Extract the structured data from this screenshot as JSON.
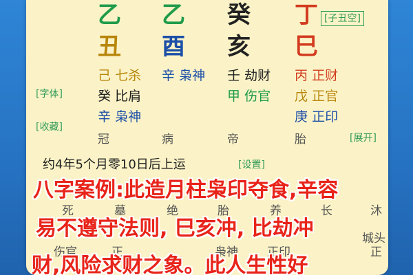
{
  "pillars": {
    "stems": [
      {
        "char": "乙",
        "color": "#1f9b4a"
      },
      {
        "char": "乙",
        "color": "#1f9b4a"
      },
      {
        "char": "癸",
        "color": "#222222"
      },
      {
        "char": "丁",
        "color": "#d23b1f"
      }
    ],
    "branches": [
      {
        "char": "丑",
        "color": "#b8860b"
      },
      {
        "char": "酉",
        "color": "#1c4fa8"
      },
      {
        "char": "亥",
        "color": "#222222"
      },
      {
        "char": "巳",
        "color": "#d23b1f"
      }
    ],
    "void_label": "[子丑空]"
  },
  "hidden_stems": {
    "col1": [
      {
        "stem": "己",
        "god": "七杀",
        "color": "#b8860b"
      },
      {
        "stem": "癸",
        "god": "比肩",
        "color": "#222222"
      },
      {
        "stem": "辛",
        "god": "枭神",
        "color": "#1c4fa8"
      }
    ],
    "col2": [
      {
        "stem": "辛",
        "god": "枭神",
        "color": "#1c4fa8"
      }
    ],
    "col3": [
      {
        "stem": "壬",
        "god": "劫财",
        "color": "#222222"
      },
      {
        "stem": "甲",
        "god": "伤官",
        "color": "#1f9b4a"
      }
    ],
    "col4": [
      {
        "stem": "丙",
        "god": "正财",
        "color": "#d23b1f"
      },
      {
        "stem": "戊",
        "god": "正官",
        "color": "#b8860b"
      },
      {
        "stem": "庚",
        "god": "正印",
        "color": "#1c4fa8"
      }
    ]
  },
  "growth_stages": [
    "冠",
    "病",
    "帝",
    "胎"
  ],
  "side_buttons": {
    "font": "[字体]",
    "favorite": "[收藏]",
    "expand": "[展开]",
    "settings": "[设置]"
  },
  "luck_start": "约4年5个月零10日后上运",
  "lower_partial": {
    "row1": [
      "死",
      "墓",
      "绝",
      "胎",
      "养",
      "长",
      "沐"
    ],
    "row2": "城头",
    "row3": [
      "伤官",
      "正",
      "枭神",
      "正印",
      "正"
    ]
  },
  "overlay_caption": {
    "line1": "八字案例:此造月柱枭印夺食,辛容",
    "line2": "易不遵守法则, 巳亥冲, 比劫冲",
    "line3": "财,风险求财之象。此人生性好"
  },
  "colors": {
    "card_bg": "#fbf3c7",
    "page_bg": "#2672c2",
    "overlay_text": "#e8241a",
    "tag_green": "#2f9a57"
  }
}
